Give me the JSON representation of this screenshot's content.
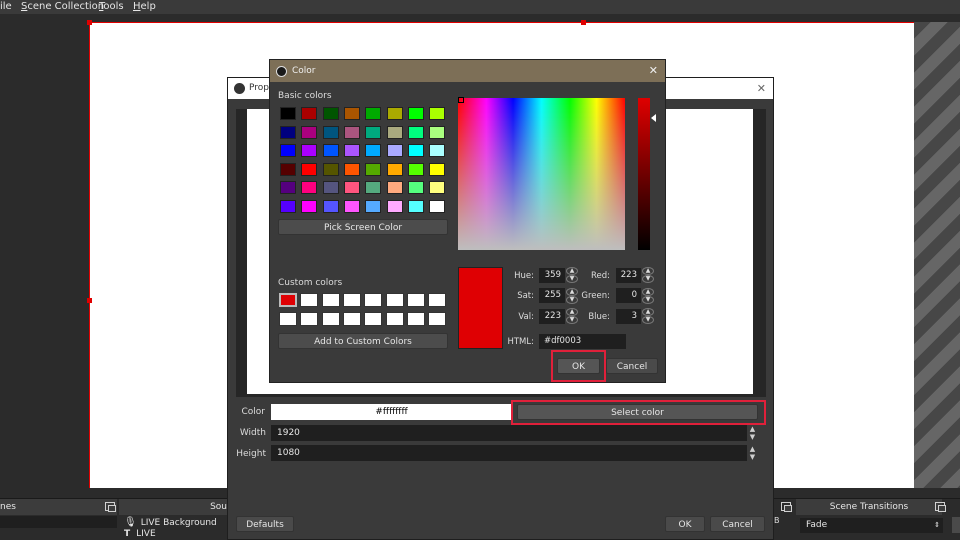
{
  "menu": {
    "file": "ile",
    "scene_collection_u": "S",
    "scene_collection_rest": "cene Collection",
    "tools_u": "T",
    "tools_rest": "ools",
    "help_u": "H",
    "help_rest": "elp"
  },
  "docks": {
    "scenes": "nes",
    "sources": "Sou",
    "transitions": "Scene Transitions",
    "transition_value": "Fade",
    "source_items": [
      "LIVE Background",
      "LIVE"
    ],
    "audio_hint": "B"
  },
  "properties": {
    "title": "Prop",
    "color_label": "Color",
    "color_value": "#ffffffff",
    "select_color": "Select color",
    "width_label": "Width",
    "width_value": "1920",
    "height_label": "Height",
    "height_value": "1080",
    "defaults": "Defaults",
    "ok": "OK",
    "cancel": "Cancel",
    "close": "✕"
  },
  "color_dialog": {
    "title": "Color",
    "close": "✕",
    "basic_colors_label": "Basic colors",
    "basic_colors": [
      [
        "#000000",
        "#aa0000",
        "#005500",
        "#aa5500",
        "#00aa00",
        "#aaaa00",
        "#00ff00",
        "#aaff00"
      ],
      [
        "#00007f",
        "#aa007f",
        "#00557f",
        "#aa557f",
        "#00aa7f",
        "#aaaa7f",
        "#00ff7f",
        "#aaff7f"
      ],
      [
        "#0000ff",
        "#aa00ff",
        "#0055ff",
        "#aa55ff",
        "#00aaff",
        "#aaaaff",
        "#00ffff",
        "#aaffff"
      ],
      [
        "#550000",
        "#ff0000",
        "#555500",
        "#ff5500",
        "#55aa00",
        "#ffaa00",
        "#55ff00",
        "#ffff00"
      ],
      [
        "#55007f",
        "#ff007f",
        "#55557f",
        "#ff557f",
        "#55aa7f",
        "#ffaa7f",
        "#55ff7f",
        "#ffff7f"
      ],
      [
        "#5500ff",
        "#ff00ff",
        "#5555ff",
        "#ff55ff",
        "#55aaff",
        "#ffaaff",
        "#55ffff",
        "#ffffff"
      ]
    ],
    "pick_screen_color": "Pick Screen Color",
    "custom_colors_label": "Custom colors",
    "custom_colors": [
      "#df0003",
      "#ffffff",
      "#ffffff",
      "#ffffff",
      "#ffffff",
      "#ffffff",
      "#ffffff",
      "#ffffff",
      "#ffffff",
      "#ffffff",
      "#ffffff",
      "#ffffff",
      "#ffffff",
      "#ffffff",
      "#ffffff",
      "#ffffff"
    ],
    "add_to_custom": "Add to Custom Colors",
    "hue_label": "Hue:",
    "hue": "359",
    "sat_label": "Sat:",
    "sat": "255",
    "val_label": "Val:",
    "val": "223",
    "red_label": "Red:",
    "red": "223",
    "green_label": "Green:",
    "green": "0",
    "blue_label": "Blue:",
    "blue": "3",
    "html_label": "HTML:",
    "html": "#df0003",
    "current_color": "#df0003",
    "ok": "OK",
    "cancel": "Cancel"
  },
  "colors": {
    "highlight": "#e0203a",
    "selection_border": "#e00000",
    "dialog_title_bar": "#7d6f57"
  }
}
